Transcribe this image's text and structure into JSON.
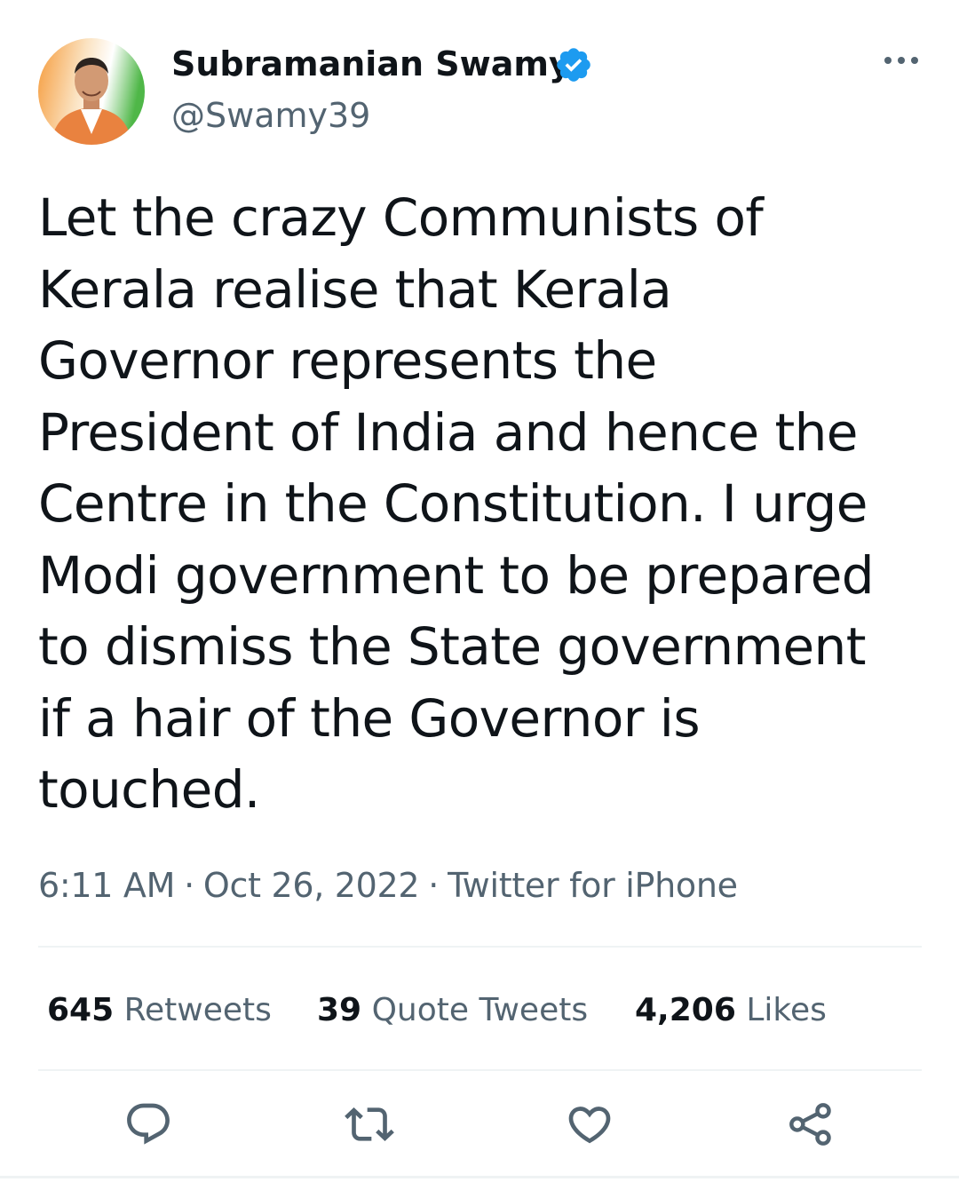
{
  "author": {
    "name": "Subramanian Swamy",
    "handle": "@Swamy39",
    "verified": true,
    "avatar": "profile-photo"
  },
  "tweet": {
    "text": "Let the crazy Communists of\nKerala realise that Kerala\nGovernor represents the\nPresident of India and hence the\nCentre in the Constitution. I urge\nModi government to be prepared\nto dismiss the State government\nif a hair of the Governor is\ntouched."
  },
  "meta": {
    "time": "6:11 AM",
    "separator": "·",
    "date": "Oct 26, 2022",
    "source": "Twitter for iPhone"
  },
  "stats": {
    "retweets": {
      "count": "645",
      "label": "Retweets"
    },
    "quotes": {
      "count": "39",
      "label": "Quote Tweets"
    },
    "likes": {
      "count": "4,206",
      "label": "Likes"
    }
  },
  "actions": {
    "reply": "reply-icon",
    "retweet": "retweet-icon",
    "like": "heart-icon",
    "share": "share-icon",
    "more": "more-icon"
  },
  "colors": {
    "text": "#0f1419",
    "secondary": "#536471",
    "verified": "#1d9bf0",
    "divider": "#eff3f4"
  }
}
